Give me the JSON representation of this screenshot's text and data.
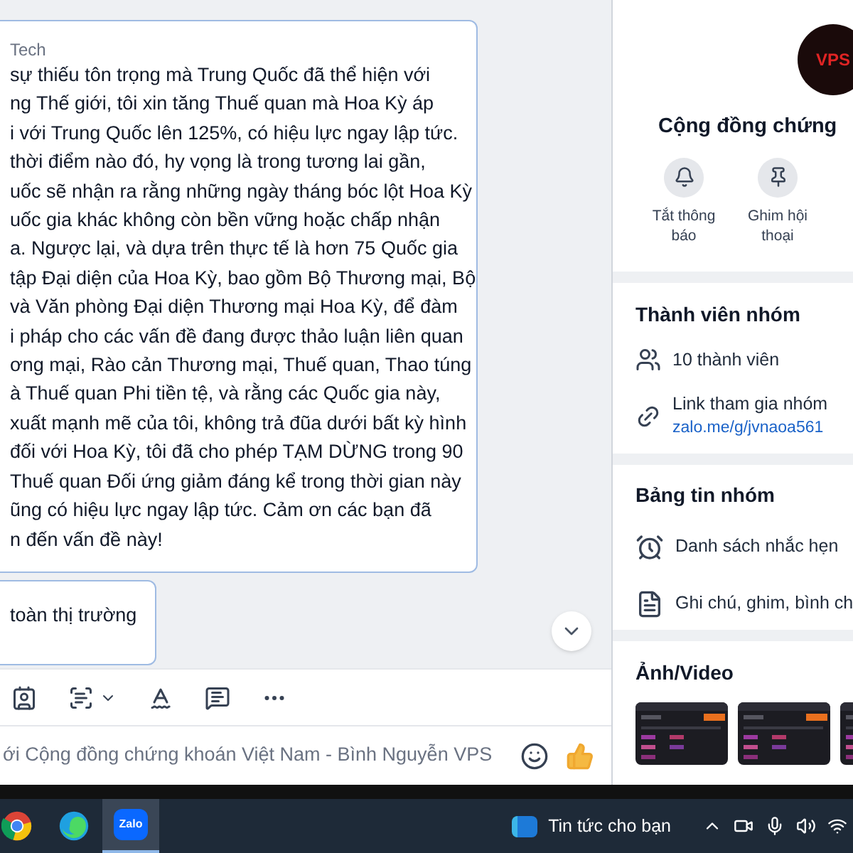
{
  "chat": {
    "message": {
      "sender": "Tech",
      "lines": [
        "sự thiếu tôn trọng mà Trung Quốc đã thể hiện với",
        "ng Thế giới, tôi xin tăng Thuế quan mà Hoa Kỳ áp",
        "i với Trung Quốc lên 125%, có hiệu lực ngay lập tức.",
        "thời điểm nào đó, hy vọng là trong tương lai gần,",
        "uốc sẽ nhận ra rằng những ngày tháng bóc lột Hoa Kỳ",
        "uốc gia khác không còn bền vững hoặc chấp nhận",
        "a. Ngược lại, và dựa trên thực tế là hơn 75 Quốc gia",
        "tập Đại diện của Hoa Kỳ, bao gồm Bộ Thương mại, Bộ",
        "và Văn phòng Đại diện Thương mại Hoa Kỳ, để đàm",
        "i pháp cho các vấn đề đang được thảo luận liên quan",
        "ơng mại, Rào cản Thương mại, Thuế quan, Thao túng",
        "à Thuế quan Phi tiền tệ, và rằng các Quốc gia này,",
        "xuất mạnh mẽ của tôi, không trả đũa dưới bất kỳ hình",
        "đối với Hoa Kỳ, tôi đã cho phép TẠM DỪNG trong 90",
        "Thuế quan Đối ứng giảm đáng kể trong thời gian này",
        "ũng có hiệu lực ngay lập tức. Cảm ơn các bạn đã",
        "n đến vấn đề này!"
      ]
    },
    "message_2": {
      "text": "toàn thị trường"
    },
    "input": {
      "placeholder": "ới Cộng đồng chứng khoán Việt Nam - Bình Nguyễn VPS"
    }
  },
  "info_panel": {
    "avatar_text": "VPS",
    "group_name": "Cộng đồng chứng",
    "actions": [
      {
        "kind": "bell",
        "label": "Tắt thông báo"
      },
      {
        "kind": "pin",
        "label": "Ghim hội thoại"
      }
    ],
    "members": {
      "title": "Thành viên nhóm",
      "count": "10 thành viên",
      "link_label": "Link tham gia nhóm",
      "link": "zalo.me/g/jvnaoa561"
    },
    "board": {
      "title": "Bảng tin nhóm",
      "items": [
        {
          "kind": "alarm",
          "label": "Danh sách nhắc hẹn"
        },
        {
          "kind": "note",
          "label": "Ghi chú, ghim, bình ch"
        }
      ]
    },
    "media": {
      "title": "Ảnh/Video"
    }
  },
  "taskbar": {
    "apps": [
      {
        "kind": "chrome",
        "selected": false
      },
      {
        "kind": "edge",
        "selected": false
      },
      {
        "kind": "zalo",
        "label": "Zalo",
        "selected": true
      }
    ],
    "news": "Tin tức cho bạn"
  }
}
